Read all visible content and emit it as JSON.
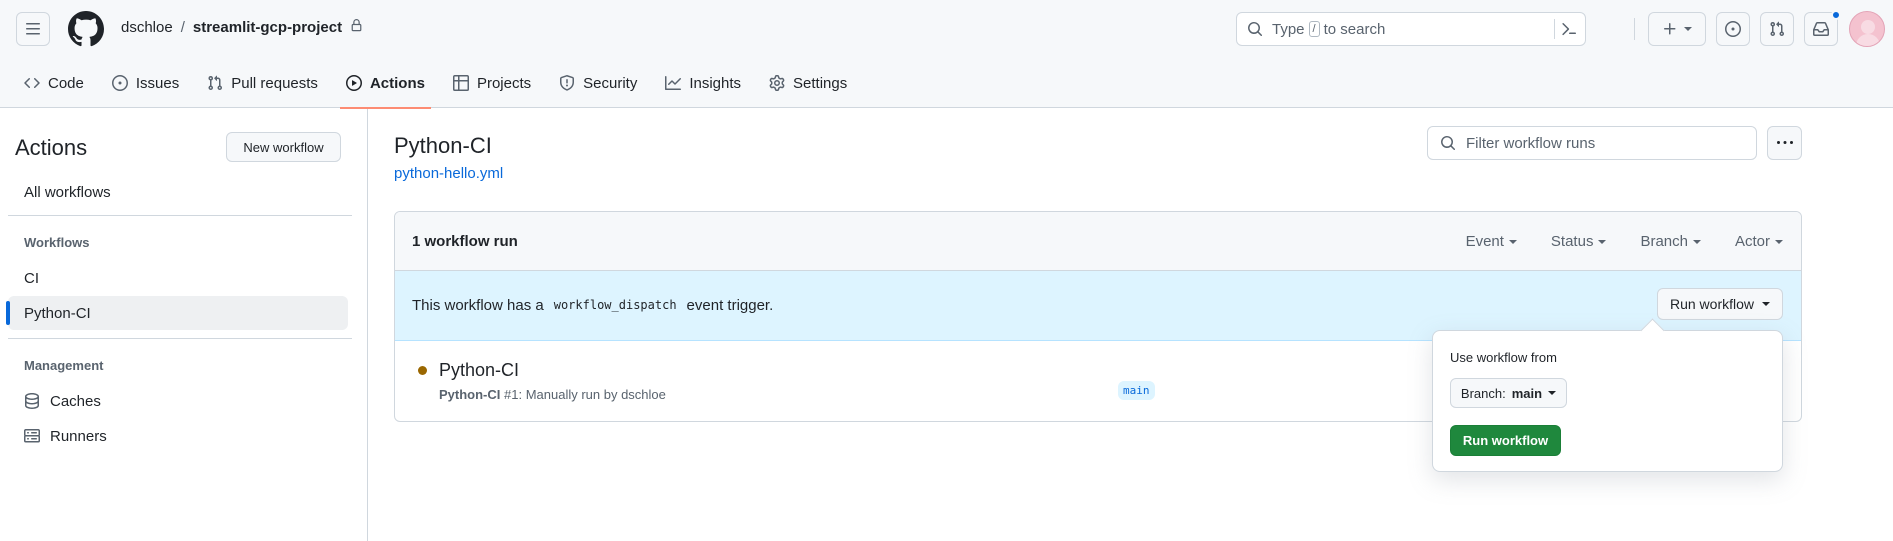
{
  "header": {
    "owner": "dschloe",
    "separator": "/",
    "repo": "streamlit-gcp-project",
    "search": {
      "prefix": "Type",
      "key": "/",
      "suffix": "to search"
    },
    "icons": [
      "hamburger-icon",
      "github-logo-icon",
      "lock-icon",
      "search-icon",
      "command-palette-icon",
      "plus-icon",
      "issue-opened-icon",
      "git-pull-request-icon",
      "inbox-icon"
    ]
  },
  "nav": {
    "tabs": [
      {
        "label": "Code",
        "icon": "code-icon"
      },
      {
        "label": "Issues",
        "icon": "issue-opened-icon"
      },
      {
        "label": "Pull requests",
        "icon": "git-pull-request-icon"
      },
      {
        "label": "Actions",
        "icon": "play-icon",
        "active": true
      },
      {
        "label": "Projects",
        "icon": "table-icon"
      },
      {
        "label": "Security",
        "icon": "shield-icon"
      },
      {
        "label": "Insights",
        "icon": "graph-icon"
      },
      {
        "label": "Settings",
        "icon": "gear-icon"
      }
    ]
  },
  "sidebar": {
    "title": "Actions",
    "new_workflow": "New workflow",
    "all_workflows": "All workflows",
    "workflows_heading": "Workflows",
    "workflows": [
      {
        "label": "CI"
      },
      {
        "label": "Python-CI",
        "selected": true
      }
    ],
    "management_heading": "Management",
    "management": [
      {
        "label": "Caches",
        "icon": "database-icon"
      },
      {
        "label": "Runners",
        "icon": "server-icon"
      }
    ]
  },
  "main": {
    "title": "Python-CI",
    "file": "python-hello.yml",
    "filter_placeholder": "Filter workflow runs",
    "runs_count": "1 workflow run",
    "filters": [
      "Event",
      "Status",
      "Branch",
      "Actor"
    ],
    "dispatch": {
      "before": "This workflow has a",
      "code": "workflow_dispatch",
      "after": "event trigger.",
      "button": "Run workflow"
    },
    "run": {
      "title": "Python-CI",
      "meta_name": "Python-CI",
      "meta_rest": "#1: Manually run by dschloe",
      "branch": "main",
      "status_color": "#9a6700"
    }
  },
  "popover": {
    "label": "Use workflow from",
    "branch_prefix": "Branch:",
    "branch_value": "main",
    "run_button": "Run workflow"
  },
  "colors": {
    "accent": "#0969da",
    "active_tab_underline": "#fd8c73",
    "primary_button": "#1f883d",
    "dispatch_bg": "#ddf4ff"
  }
}
